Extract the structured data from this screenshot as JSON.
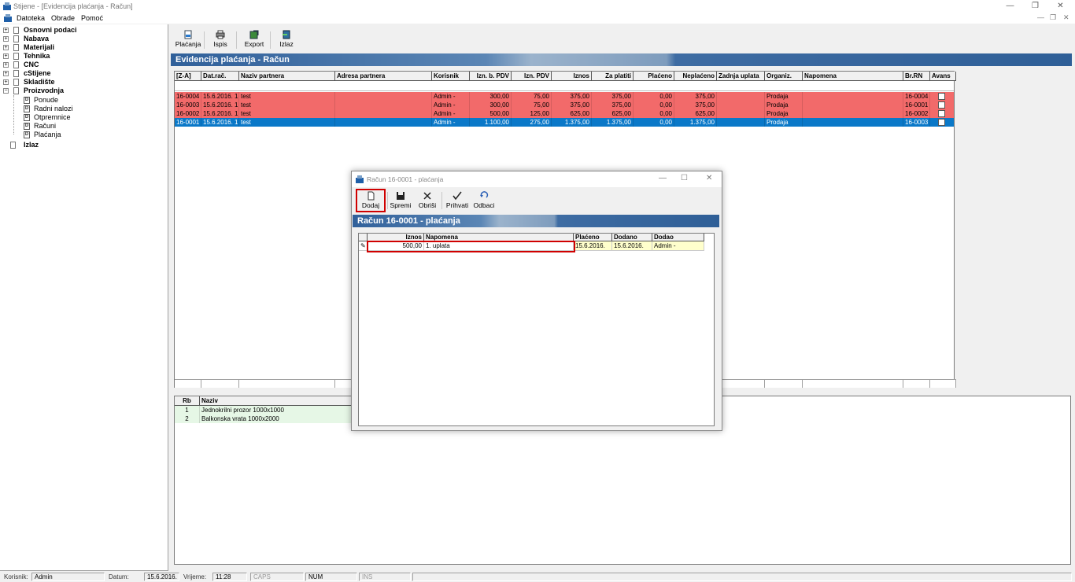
{
  "window": {
    "title": "Stijene - [Evidencija plaćanja - Račun]"
  },
  "menu": [
    "Datoteka",
    "Obrade",
    "Pomoć"
  ],
  "tree": {
    "items": [
      {
        "label": "Osnovni podaci"
      },
      {
        "label": "Nabava"
      },
      {
        "label": "Materijali"
      },
      {
        "label": "Tehnika"
      },
      {
        "label": "CNC"
      },
      {
        "label": "cStijene"
      },
      {
        "label": "Skladište"
      },
      {
        "label": "Proizvodnja"
      },
      {
        "label": "Ponude"
      },
      {
        "label": "Radni nalozi"
      },
      {
        "label": "Otpremnice"
      },
      {
        "label": "Računi"
      },
      {
        "label": "Plaćanja"
      },
      {
        "label": "Izlaz"
      }
    ]
  },
  "toolbar": {
    "placanja": "Plaćanja",
    "ispis": "Ispis",
    "export": "Export",
    "izlaz": "Izlaz"
  },
  "main": {
    "header": "Evidencija plaćanja - Račun",
    "columns": [
      "[Z-A]",
      "Dat.rač.",
      "Naziv partnera",
      "Adresa partnera",
      "Korisnik",
      "Izn. b. PDV",
      "Izn. PDV",
      "Iznos",
      "Za platiti",
      "Plaćeno",
      "Neplaćeno",
      "Zadnja uplata",
      "Organiz.",
      "Napomena",
      "Br.RN",
      "Avans"
    ],
    "rows": [
      [
        "16-0004",
        "15.6.2016. 1",
        "test",
        "",
        "Admin -",
        "300,00",
        "75,00",
        "375,00",
        "375,00",
        "0,00",
        "375,00",
        "",
        "Prodaja",
        "",
        "16-0004",
        ""
      ],
      [
        "16-0003",
        "15.6.2016. 1(",
        "test",
        "",
        "Admin -",
        "300,00",
        "75,00",
        "375,00",
        "375,00",
        "0,00",
        "375,00",
        "",
        "Prodaja",
        "",
        "16-0001",
        ""
      ],
      [
        "16-0002",
        "15.6.2016. 1(",
        "test",
        "",
        "Admin -",
        "500,00",
        "125,00",
        "625,00",
        "625,00",
        "0,00",
        "625,00",
        "",
        "Prodaja",
        "",
        "16-0002",
        ""
      ],
      [
        "16-0001",
        "15.6.2016. 1(",
        "test",
        "",
        "Admin -",
        "1.100,00",
        "275,00",
        "1.375,00",
        "1.375,00",
        "0,00",
        "1.375,00",
        "",
        "Prodaja",
        "",
        "16-0003",
        ""
      ]
    ],
    "colors": {
      "row": "#f26a6a",
      "selected": "#0a78c8"
    }
  },
  "items": {
    "columns": [
      "Rb",
      "Naziv"
    ],
    "rows": [
      [
        "1",
        "Jednokrilni prozor 1000x1000"
      ],
      [
        "2",
        "Balkonska vrata 1000x2000"
      ]
    ]
  },
  "dialog": {
    "title": "Račun 16-0001 - plaćanja",
    "header": "Račun 16-0001 - plaćanja",
    "toolbar": {
      "dodaj": "Dodaj",
      "spremi": "Spremi",
      "obrisi": "Obriši",
      "prihvati": "Prihvati",
      "odbaci": "Odbaci"
    },
    "columns": [
      "Iznos",
      "Napomena",
      "Plaćeno",
      "Dodano",
      "Dodao"
    ],
    "row": {
      "iznos": "500,00",
      "napomena": "1. uplata",
      "placeno": "15.6.2016.",
      "dodano": "15.6.2016.",
      "dodao": "Admin -"
    }
  },
  "status": {
    "korisnik_label": "Korisnik:",
    "korisnik": "Admin",
    "datum_label": "Datum:",
    "datum": "15.6.2016.",
    "vrijeme_label": "Vrijeme:",
    "vrijeme": "11:28",
    "caps": "CAPS",
    "num": "NUM",
    "ins": "INS"
  }
}
